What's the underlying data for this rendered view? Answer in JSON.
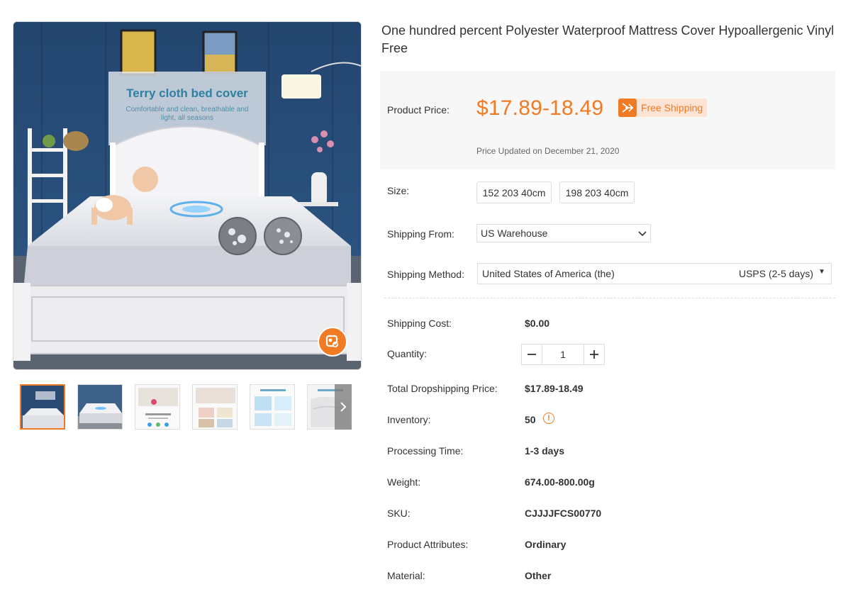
{
  "product": {
    "title": "One hundred percent Polyester Waterproof Mattress Cover Hypoallergenic Vinyl Free"
  },
  "image": {
    "headline": "Terry cloth bed cover",
    "subline1": "Comfortable and clean, breathable and",
    "subline2": "light, all seasons",
    "thumbnail_count": 6,
    "active_thumbnail": 0
  },
  "price": {
    "label": "Product Price:",
    "value": "$17.89-18.49",
    "free_shipping": "Free Shipping",
    "updated": "Price Updated on December 21, 2020"
  },
  "size": {
    "label": "Size:",
    "options": [
      "152 203 40cm",
      "198 203 40cm"
    ]
  },
  "shipping_from": {
    "label": "Shipping From:",
    "selected": "US Warehouse"
  },
  "shipping_method": {
    "label": "Shipping Method:",
    "country": "United States of America (the)",
    "method": "USPS (2-5 days)"
  },
  "details": {
    "shipping_cost": {
      "label": "Shipping Cost:",
      "value": "$0.00"
    },
    "quantity": {
      "label": "Quantity:",
      "value": "1"
    },
    "total": {
      "label": "Total Dropshipping Price:",
      "value": "$17.89-18.49"
    },
    "inventory": {
      "label": "Inventory:",
      "value": "50"
    },
    "processing": {
      "label": "Processing Time:",
      "value": "1-3 days"
    },
    "weight": {
      "label": "Weight:",
      "value": "674.00-800.00g"
    },
    "sku": {
      "label": "SKU:",
      "value": "CJJJJFCS00770"
    },
    "attributes": {
      "label": "Product Attributes:",
      "value": "Ordinary"
    },
    "material": {
      "label": "Material:",
      "value": "Other"
    }
  },
  "colors": {
    "accent": "#f07b24",
    "free_ship_bg": "#fde3d4",
    "price_box_bg": "#f7f7f7"
  },
  "icons": [
    "zoom-icon",
    "chevron-right-icon",
    "truck-icon",
    "chevron-down-icon",
    "warning-icon"
  ]
}
